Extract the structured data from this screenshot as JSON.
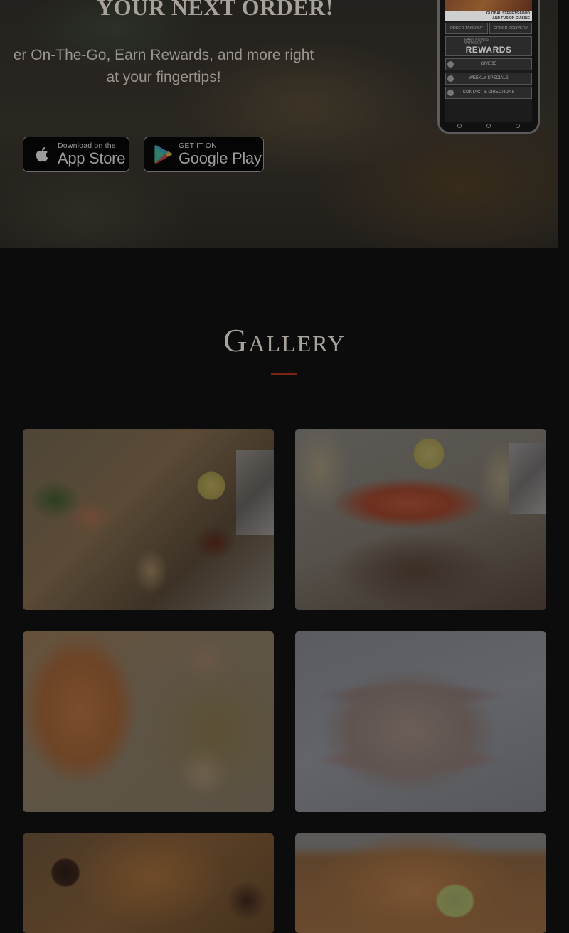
{
  "app_promo": {
    "title": "YOUR NEXT ORDER!",
    "subtitle_line1": "er On-The-Go, Earn Rewards, and more right",
    "subtitle_line2": "at your fingertips!",
    "app_store": {
      "small": "Download on the",
      "big": "App Store"
    },
    "google_play": {
      "small": "GET IT ON",
      "big": "Google Play"
    },
    "phone": {
      "brand_line1": "GLOBAL STREETS FOOD",
      "brand_line2": "AND FUSION CUISINE",
      "order_takeout": "ORDER TAKEOUT",
      "order_delivery": "ORDER DELIVERY",
      "earn_points_1": "EARN POINTS",
      "earn_points_2": "WITH OUR",
      "rewards": "REWARDS",
      "give": "GIVE $5",
      "weekly_specials": "WEEKLY SPECIALS",
      "contact": "CONTACT & DIRECTIONS"
    }
  },
  "gallery": {
    "title": "Gallery",
    "accent_color": "#7c2513"
  }
}
